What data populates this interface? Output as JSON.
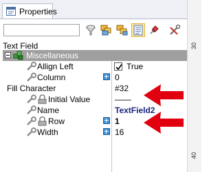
{
  "tab": {
    "label": "Properties",
    "icon": "properties-icon"
  },
  "toolbar": {
    "search_value": "",
    "icons": [
      "filter-icon",
      "category-icon",
      "alphabetical-icon",
      "properties-view-icon",
      "pin-icon",
      "tools-icon"
    ]
  },
  "object_name": "Text Field",
  "category": {
    "label": "Miscellaneous",
    "expanded": true
  },
  "properties": [
    {
      "name": "Allign Left",
      "value": "True",
      "checkbox": true,
      "checked": true
    },
    {
      "name": "Column",
      "value": "0",
      "badge": true
    },
    {
      "name": "Fill Character",
      "value": "#32"
    },
    {
      "name": "Initial Value",
      "value": "——"
    },
    {
      "name": "Name",
      "value": "TextField2"
    },
    {
      "name": "Row",
      "value": "1",
      "badge": true
    },
    {
      "name": "Width",
      "value": "16",
      "badge": true
    }
  ],
  "ruler": {
    "ticks": [
      "30",
      "40"
    ]
  },
  "colors": {
    "category_bg": "#9f9f9f",
    "arrow": "#e0000f",
    "value_emphasis": "#1a237e"
  }
}
